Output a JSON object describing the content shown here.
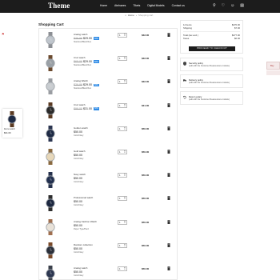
{
  "header": {
    "logo": "Theme",
    "nav": [
      "Home",
      "Atelnares",
      "Tikets",
      "Digital Models",
      "Contact us"
    ],
    "icons": [
      "search-icon",
      "heart-icon",
      "user-icon",
      "bag-icon"
    ]
  },
  "breadcrumb": {
    "home": "Home",
    "current": "Shopping cart"
  },
  "page_title": "Shopping Cart",
  "cart_items": [
    {
      "name": "Analog watch",
      "old_price": "$39.99",
      "price": "$29.00",
      "sale": "50%",
      "variant": "Stainless/Black/Sun",
      "qty": "1",
      "subtotal": "$32.00",
      "dial": "#bfc5cc",
      "strap": "#8c8f94"
    },
    {
      "name": "Cruz watch",
      "old_price": "$65.00",
      "price": "$29.00",
      "sale": "50%",
      "variant": "Stainless/Black/Sun",
      "qty": "1",
      "subtotal": "$32.00",
      "dial": "#9aa0a6",
      "strap": "#6b4a2e"
    },
    {
      "name": "Analog Watch",
      "old_price": "$39.99",
      "price": "$29.00",
      "sale": "50%",
      "variant": "Stainless/Black/Sun",
      "qty": "1",
      "subtotal": "$32.00",
      "dial": "#c8ccd0",
      "strap": "#9a9da2"
    },
    {
      "name": "Cruz watch",
      "old_price": "$99.00",
      "price": "$31.00",
      "sale": "50%",
      "variant": "",
      "qty": "1",
      "subtotal": "$31.00",
      "dial": "#2a2a2a",
      "strap": "#5a3a22"
    },
    {
      "name": "Golden watch",
      "old_price": "",
      "price": "$50.00",
      "sale": "",
      "variant": "Color/Navy",
      "qty": "1",
      "subtotal": "$50.00",
      "dial": "#1e2a45",
      "strap": "#2b3550"
    },
    {
      "name": "Gold watch",
      "old_price": "",
      "price": "$50.00",
      "sale": "",
      "variant": "Color/Navy",
      "qty": "1",
      "subtotal": "$50.00",
      "dial": "#e7d7b8",
      "strap": "#8a6a40"
    },
    {
      "name": "Navy watch",
      "old_price": "",
      "price": "$50.00",
      "sale": "",
      "variant": "Color/Navy",
      "qty": "1",
      "subtotal": "$50.00",
      "dial": "#22304f",
      "strap": "#26324d"
    },
    {
      "name": "Professional watch",
      "old_price": "",
      "price": "$50.00",
      "sale": "",
      "variant": "Color/Navy",
      "qty": "1",
      "subtotal": "$50.00",
      "dial": "#1c2740",
      "strap": "#2d2d2d"
    },
    {
      "name": "Analog Fashion Watch",
      "old_price": "",
      "price": "$50.00",
      "sale": "",
      "variant": "Paper Type/Hard",
      "qty": "1",
      "subtotal": "$50.00",
      "dial": "#e9e2d8",
      "strap": "#a07050"
    },
    {
      "name": "Random collection",
      "old_price": "",
      "price": "$50.00",
      "sale": "",
      "variant": "Color/Navy",
      "qty": "1",
      "subtotal": "$50.00",
      "dial": "#2a2f3a",
      "strap": "#7a4a2a"
    },
    {
      "name": "Analog watch",
      "old_price": "",
      "price": "$50.00",
      "sale": "",
      "variant": "Color/Navy",
      "qty": "1",
      "subtotal": "$50.00",
      "dial": "#2c3650",
      "strap": "#3a3f4a"
    }
  ],
  "totals": {
    "subtotal_label": "14 items",
    "subtotal_value": "$470.00",
    "shipping_label": "Shipping",
    "shipping_value": "$7.00",
    "total_label": "Total (tax excl.)",
    "total_value": "$477.00",
    "taxes_label": "Taxes",
    "taxes_value": "$0.00",
    "checkout_label": "PROCEED TO CHECKOUT"
  },
  "policies": [
    {
      "title": "Security policy",
      "desc": "(edit with the Customer Reassurance module)"
    },
    {
      "title": "Delivery policy",
      "desc": "(edit with the Customer Reassurance module)"
    },
    {
      "title": "Return policy",
      "desc": "(edit with the Customer Reassurance module)"
    }
  ],
  "popup_product": {
    "label": "Demo watch",
    "price": "$31.00"
  },
  "side_tab": "Buy"
}
